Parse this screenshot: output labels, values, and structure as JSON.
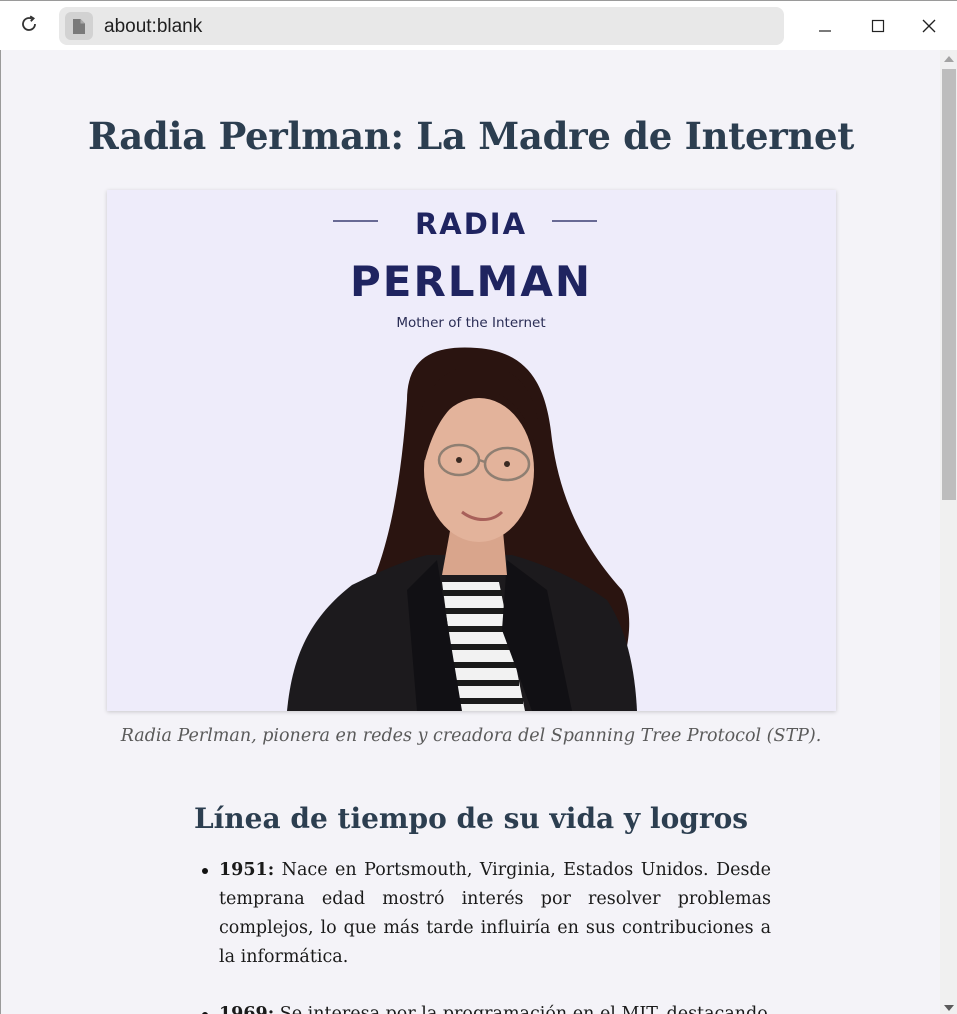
{
  "browser": {
    "url": "about:blank",
    "icons": [
      "reload-icon",
      "page-icon",
      "minimize-icon",
      "maximize-icon",
      "close-icon"
    ]
  },
  "page": {
    "title": "Radia Perlman: La Madre de Internet",
    "portrait": {
      "label_first": "RADIA",
      "label_last": "PERLMAN",
      "label_tagline": "Mother of the Internet"
    },
    "caption": "Radia Perlman, pionera en redes y creadora del Spanning Tree Protocol (STP).",
    "section_title": "Línea de tiempo de su vida y logros",
    "timeline": [
      {
        "year": "1951:",
        "text": " Nace en Portsmouth, Virginia, Estados Unidos. Desde temprana edad mostró interés por resolver problemas complejos, lo que más tarde influiría en sus contribuciones a la informática."
      },
      {
        "year": "1969:",
        "text": " Se interesa por la programación en el MIT, destacando"
      }
    ]
  },
  "colors": {
    "heading": "#2c3e50",
    "portrait_bg": "#eeecfa",
    "portrait_label": "#1f2460",
    "page_bg": "#f4f3f8"
  }
}
